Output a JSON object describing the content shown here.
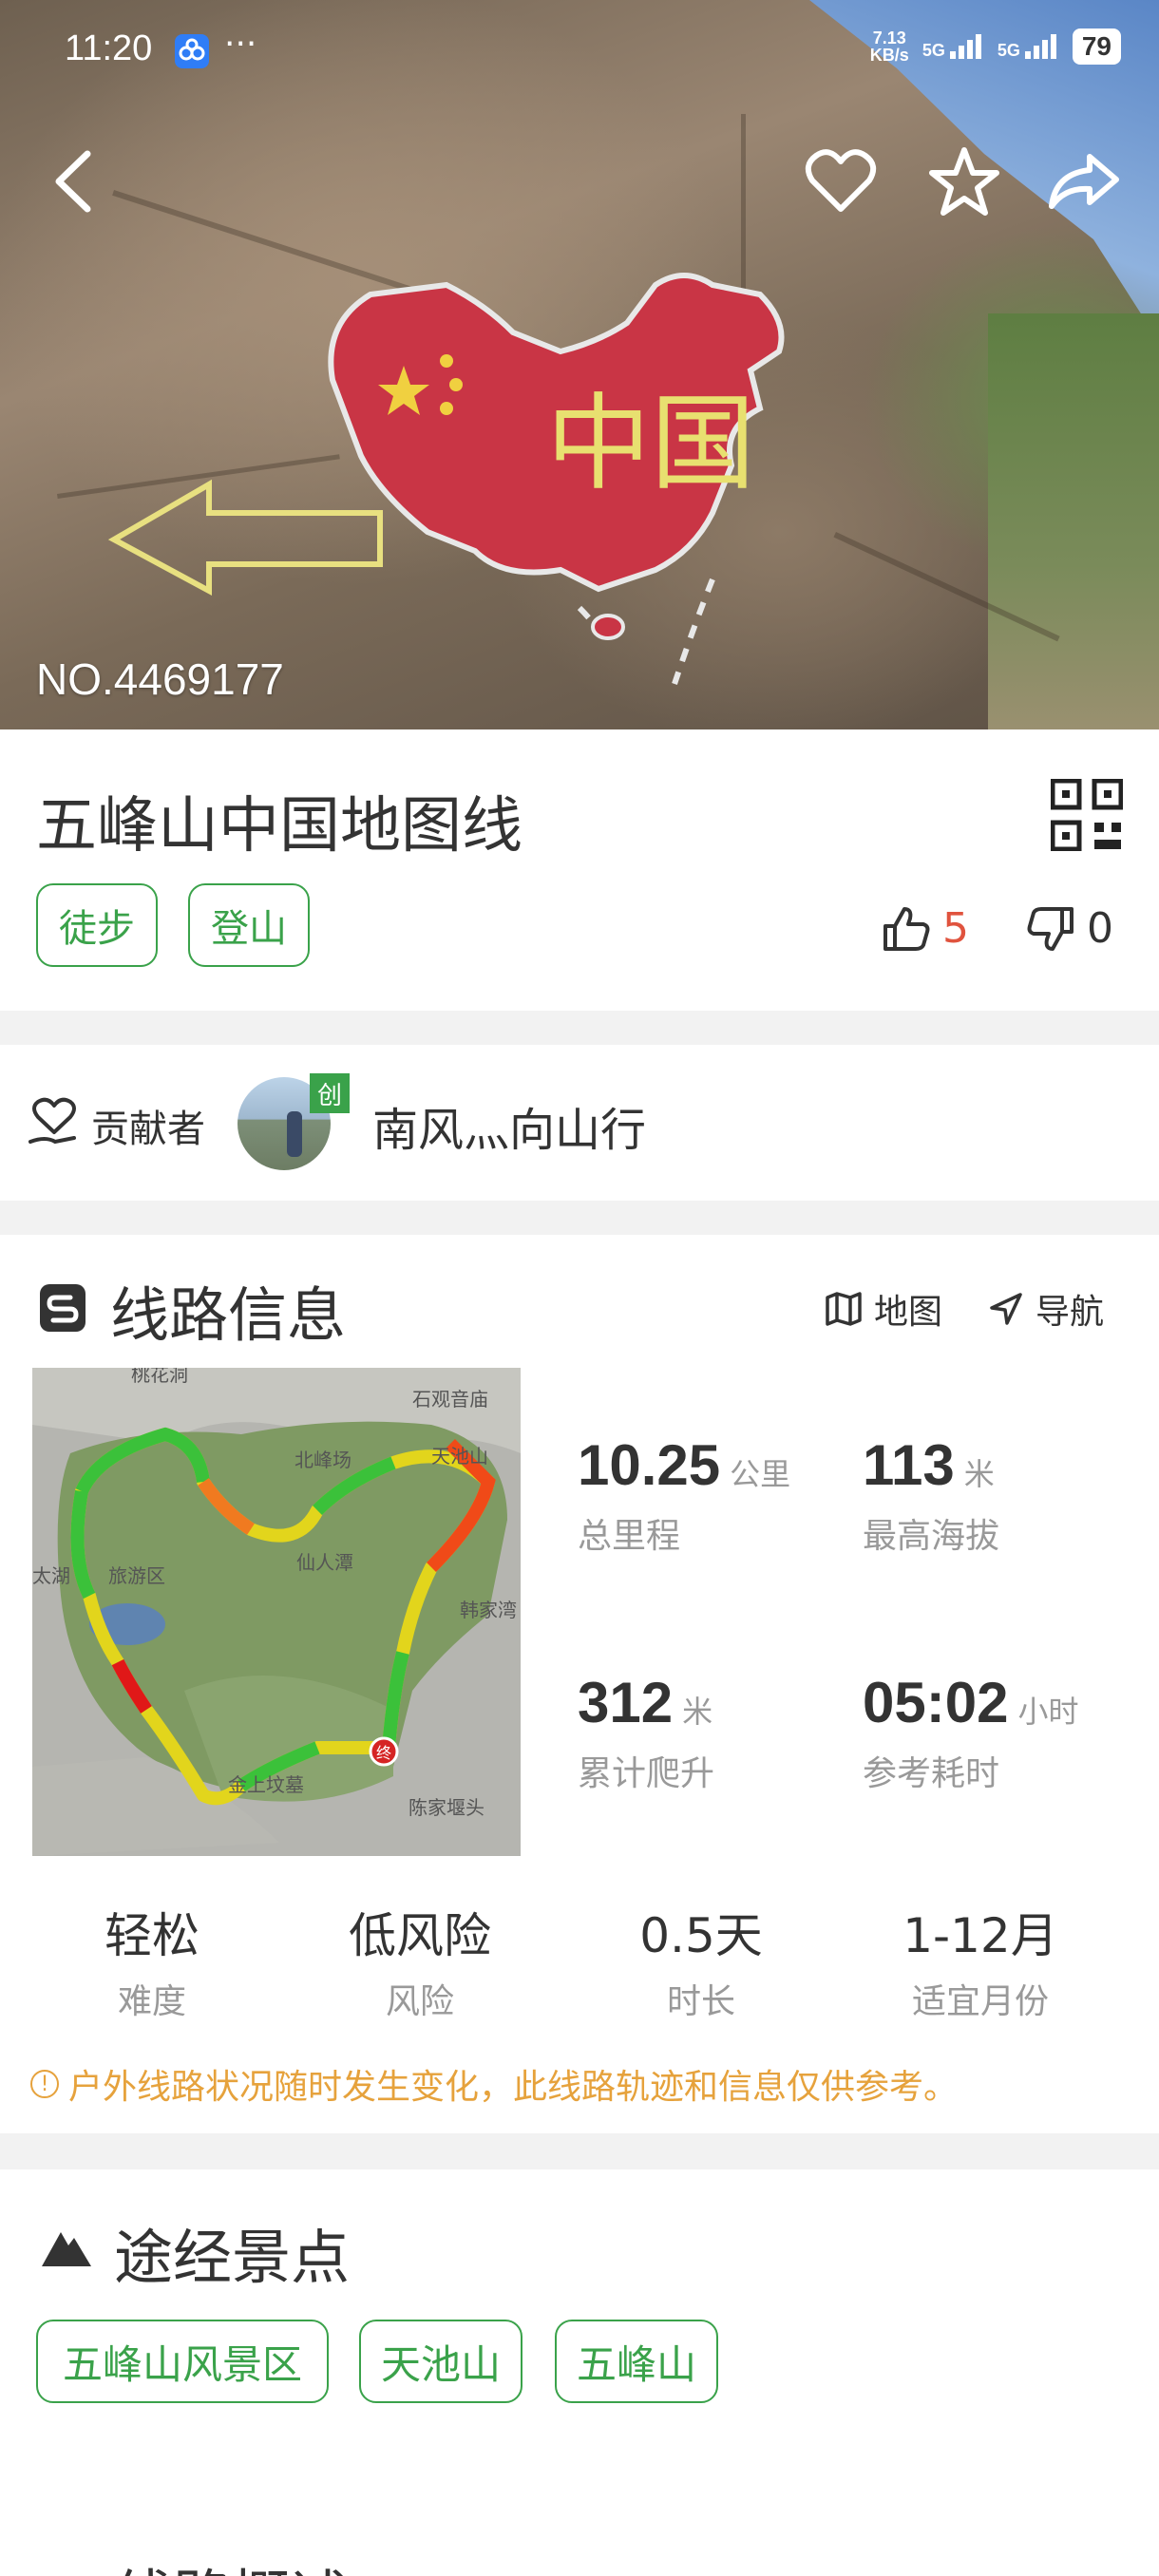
{
  "status_bar": {
    "time": "11:20",
    "dots": "···",
    "net_speed_top": "7.13",
    "net_speed_bottom": "KB/s",
    "sig1": "5G",
    "sig2": "5G",
    "battery": "79"
  },
  "hero": {
    "route_no": "NO.4469177",
    "rock_text": "中国"
  },
  "route": {
    "title": "五峰山中国地图线",
    "tags": [
      "徒步",
      "登山"
    ],
    "likes": "5",
    "dislikes": "0"
  },
  "contributor": {
    "label": "贡献者",
    "badge": "创",
    "name": "南风灬向山行"
  },
  "route_info": {
    "section_title": "线路信息",
    "map_label": "地图",
    "nav_label": "导航",
    "map_places": [
      "桃花洞",
      "石观音庙",
      "北峰场",
      "天池山",
      "太湖",
      "旅游区",
      "仙人潭",
      "韩家湾",
      "金上坟墓",
      "陈家堰头"
    ],
    "end_marker": "终",
    "stats": [
      {
        "value": "10.25",
        "unit": "公里",
        "label": "总里程"
      },
      {
        "value": "113",
        "unit": "米",
        "label": "最高海拔"
      },
      {
        "value": "312",
        "unit": "米",
        "label": "累计爬升"
      },
      {
        "value": "05:02",
        "unit": "小时",
        "label": "参考耗时"
      }
    ],
    "attributes": [
      {
        "value": "轻松",
        "label": "难度"
      },
      {
        "value": "低风险",
        "label": "风险"
      },
      {
        "value": "0.5天",
        "label": "时长"
      },
      {
        "value": "1-12月",
        "label": "适宜月份"
      }
    ],
    "notice": "户外线路状况随时发生变化，此线路轨迹和信息仅供参考。"
  },
  "attractions": {
    "section_title": "途经景点",
    "items": [
      "五峰山风景区",
      "天池山",
      "五峰山"
    ]
  },
  "overview": {
    "section_title": "线路概述"
  },
  "colors": {
    "brand_green": "#3aa24a",
    "like_red": "#e0533e",
    "notice_orange": "#e6a23c"
  }
}
